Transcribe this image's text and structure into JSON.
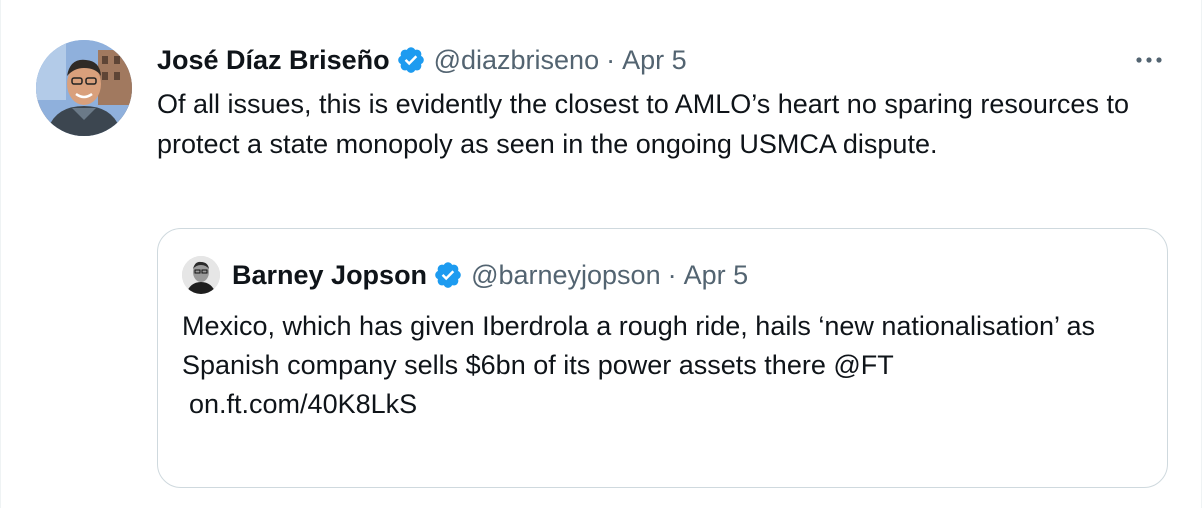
{
  "tweet": {
    "author_name": "José Díaz Briseño",
    "handle": "@diazbriseno",
    "separator": "·",
    "date": "Apr 5",
    "text": "Of all issues, this is evidently the closest to AMLO’s heart no sparing resources to protect a state monopoly as seen in the ongoing USMCA dispute.",
    "avatar_icon": "profile-photo-icon",
    "verified_icon": "verified-badge-icon",
    "more_icon": "more-options-icon"
  },
  "quoted_tweet": {
    "author_name": "Barney Jopson",
    "handle": "@barneyjopson",
    "separator": "·",
    "date": "Apr 5",
    "text_line": "Mexico, which has given Iberdrola a rough ride, hails ‘new nationalisation’ as Spanish company sells $6bn of its power assets there @FT",
    "link": "on.ft.com/40K8LkS",
    "avatar_icon": "profile-photo-icon",
    "verified_icon": "verified-badge-icon"
  },
  "colors": {
    "text_primary": "#0f1419",
    "text_secondary": "#536471",
    "verified_blue": "#1d9bf0",
    "border": "#cfd9de"
  }
}
